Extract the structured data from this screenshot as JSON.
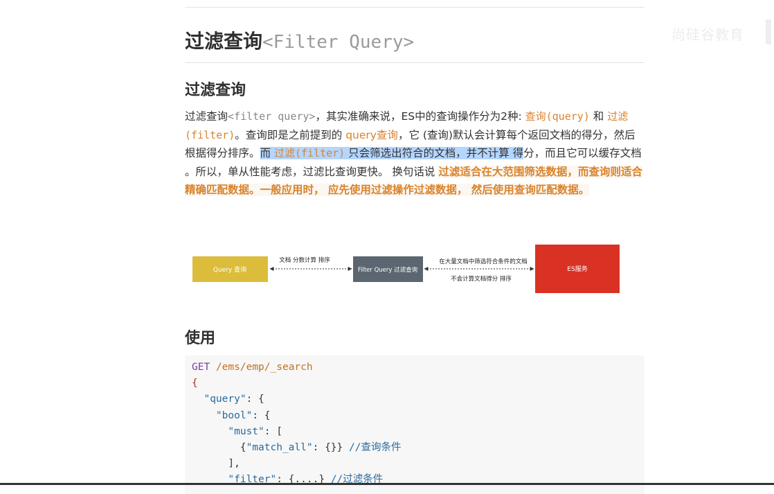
{
  "heading": {
    "title_cn": "过滤查询",
    "title_code": "<Filter Query>"
  },
  "watermark": "尚硅谷教育",
  "section1": {
    "title": "过滤查询",
    "paragraph": {
      "s1": "过滤查询",
      "s2": "<filter query>",
      "s3": "，其实准确来说，ES中的查询操作分为2种: ",
      "s4": "查询(query)",
      "s5": " 和 ",
      "s6": "过滤(filter)",
      "s7": "。查询即是之前提到的 ",
      "s8": "query查询",
      "s9": "，它 (查询)默认会计算每个返回文档的得分，然后根据得分排序。",
      "s10": "而 ",
      "s11": "过滤(filter)",
      "s12": " 只会筛选出符合的文档，并不计算 得",
      "s13": "分，而且它可以缓存文档 。所以，单从性能考虑，过滤比查询更快。 换句话说 ",
      "s14": "过滤适合在大范围筛选数据，而查询则适合精确匹配数据。一般应用时， 应先使用过滤操作过滤数据， 然后使用查询匹配数据。"
    }
  },
  "diagram": {
    "query_box": "Query 查询",
    "filter_box": "Filter Query  过滤查询",
    "es_box": "ES服务",
    "arrow1_label": "文档 分数计算 排序",
    "arrow2_label_top": "在大量文档中筛选符合条件的文档",
    "arrow2_label_bottom": "不会计算文档得分 排序",
    "colors": {
      "query": "#dcbd3b",
      "filter": "#5b6670",
      "es": "#d93224"
    }
  },
  "section2": {
    "title": "使用"
  },
  "code": {
    "method": "GET",
    "path": "/ems/emp/_search",
    "l2": "{",
    "l3_key": "\"query\"",
    "l3_rest": ": {",
    "l4_key": "\"bool\"",
    "l4_rest": ": {",
    "l5_key": "\"must\"",
    "l5_rest": ": [",
    "l6_a": "{",
    "l6_key": "\"match_all\"",
    "l6_b": ": {}} ",
    "l6_comment": "//查询条件",
    "l7": "],",
    "l8_key": "\"filter\"",
    "l8_rest": ": {....} ",
    "l8_comment": "//过滤条件"
  }
}
